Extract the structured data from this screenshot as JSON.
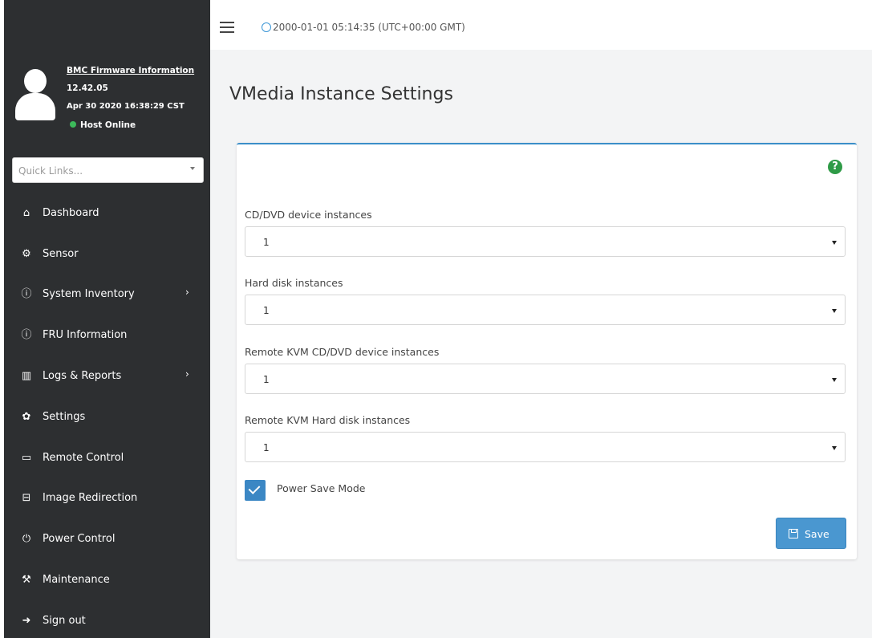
{
  "sidebar": {
    "firmware_link": "BMC Firmware Information",
    "firmware_version": "12.42.05",
    "firmware_date": "Apr 30 2020 16:38:29 CST",
    "host_status": "Host Online",
    "quick_links_placeholder": "Quick Links...",
    "items": [
      {
        "label": "Dashboard",
        "icon": "home-icon",
        "has_submenu": false
      },
      {
        "label": "Sensor",
        "icon": "sensor-icon",
        "has_submenu": false
      },
      {
        "label": "System Inventory",
        "icon": "info-icon",
        "has_submenu": true
      },
      {
        "label": "FRU Information",
        "icon": "info-icon",
        "has_submenu": false
      },
      {
        "label": "Logs & Reports",
        "icon": "chart-icon",
        "has_submenu": true
      },
      {
        "label": "Settings",
        "icon": "gear-icon",
        "has_submenu": false
      },
      {
        "label": "Remote Control",
        "icon": "monitor-icon",
        "has_submenu": false
      },
      {
        "label": "Image Redirection",
        "icon": "disk-icon",
        "has_submenu": false
      },
      {
        "label": "Power Control",
        "icon": "power-icon",
        "has_submenu": false
      },
      {
        "label": "Maintenance",
        "icon": "wrench-icon",
        "has_submenu": false
      },
      {
        "label": "Sign out",
        "icon": "sign-out-icon",
        "has_submenu": false
      }
    ]
  },
  "header": {
    "datetime": "2000-01-01 05:14:35 (UTC+00:00 GMT)"
  },
  "main": {
    "title": "VMedia Instance Settings",
    "fields": [
      {
        "label": "CD/DVD device instances",
        "value": "1"
      },
      {
        "label": "Hard disk instances",
        "value": "1"
      },
      {
        "label": "Remote KVM CD/DVD device instances",
        "value": "1"
      },
      {
        "label": "Remote KVM Hard disk instances",
        "value": "1"
      }
    ],
    "power_save_label": "Power Save Mode",
    "power_save_checked": true,
    "save_label": "Save"
  },
  "colors": {
    "sidebar_bg": "#2d2f31",
    "accent": "#3b8fc9",
    "status_online": "#3cb95a",
    "help_icon": "#2f9b47"
  }
}
